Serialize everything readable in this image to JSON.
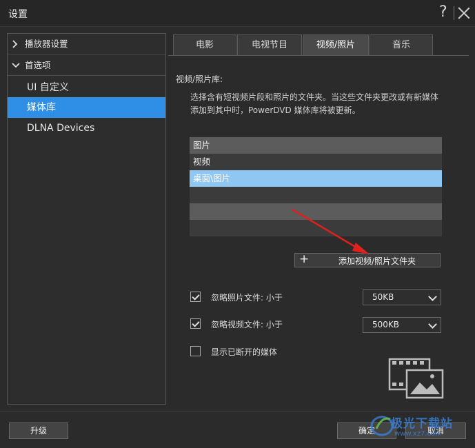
{
  "window": {
    "title": "设置",
    "help_glyph": "?"
  },
  "sidebar": {
    "groups": [
      {
        "label": "播放器设置",
        "expanded": false
      },
      {
        "label": "首选项",
        "expanded": true
      }
    ],
    "items": [
      {
        "label": "UI 自定义",
        "active": false
      },
      {
        "label": "媒体库",
        "active": true
      },
      {
        "label": "DLNA Devices",
        "active": false
      }
    ]
  },
  "tabs": [
    {
      "label": "电影",
      "active": false
    },
    {
      "label": "电视节目",
      "active": false
    },
    {
      "label": "视频/照片",
      "active": true
    },
    {
      "label": "音乐",
      "active": false
    }
  ],
  "library": {
    "section_label": "视频/照片库:",
    "description": "选择含有短视频片段和照片的文件夹。当这些文件夹更改或有新媒体添加到其中时，PowerDVD 媒体库将被更新。",
    "folders": [
      "图片",
      "视频",
      "桌面\\图片"
    ],
    "selected_index": 2,
    "add_button_label": "添加视频/照片文件夹"
  },
  "options": {
    "ignore_photo": {
      "label": "忽略照片文件: 小于",
      "checked": true,
      "value": "50KB"
    },
    "ignore_video": {
      "label": "忽略视频文件: 小于",
      "checked": true,
      "value": "500KB"
    },
    "show_disconnected": {
      "label": "显示已断开的媒体",
      "checked": false
    }
  },
  "footer": {
    "upgrade_label": "升级",
    "ok_label": "确定",
    "cancel_label": "取消"
  },
  "watermark": {
    "text": "极光下载站",
    "url": "www.xz7.com"
  },
  "colors": {
    "accent": "#2f8ee6",
    "selected_row": "#8ec6f4",
    "arrow": "#e0201c"
  }
}
